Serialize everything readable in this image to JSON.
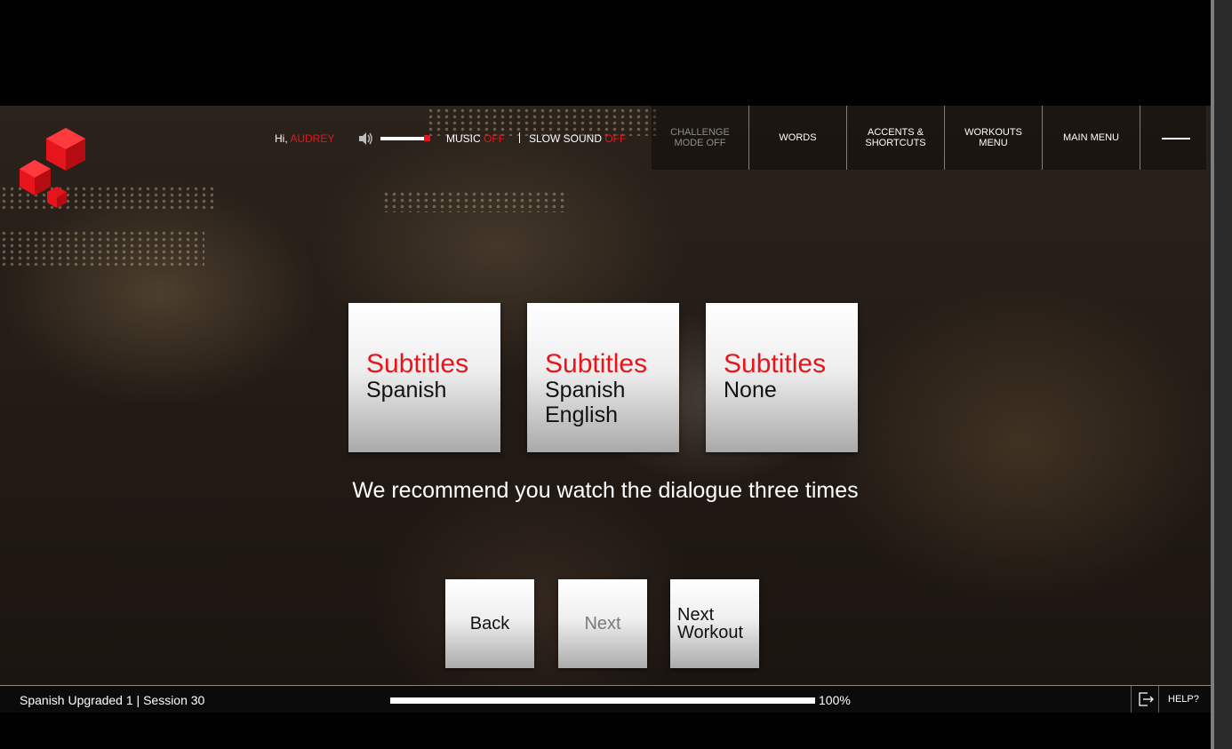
{
  "header": {
    "greeting_prefix": "Hi, ",
    "user_name": "AUDREY",
    "volume_level": 0.88,
    "music_label": "MUSIC ",
    "music_state": "OFF",
    "slow_sound_label": "SLOW SOUND ",
    "slow_sound_state": "OFF",
    "nav": [
      {
        "label": "CHALLENGE\nMODE OFF",
        "dim": true
      },
      {
        "label": "WORDS"
      },
      {
        "label": "ACCENTS &\nSHORTCUTS"
      },
      {
        "label": "WORKOUTS\nMENU"
      },
      {
        "label": "MAIN MENU"
      }
    ]
  },
  "subtitle_options": [
    {
      "heading": "Subtitles",
      "sub": "Spanish"
    },
    {
      "heading": "Subtitles",
      "sub": "Spanish\nEnglish"
    },
    {
      "heading": "Subtitles",
      "sub": "None"
    }
  ],
  "recommendation": "We recommend you watch the dialogue three times",
  "buttons": {
    "back": "Back",
    "next": "Next",
    "next_workout": "Next\nWorkout"
  },
  "footer": {
    "session": "Spanish Upgraded 1 | Session 30",
    "progress_value": 100,
    "progress_label": "100%",
    "help": "HELP?"
  },
  "colors": {
    "accent": "#e8141b"
  }
}
